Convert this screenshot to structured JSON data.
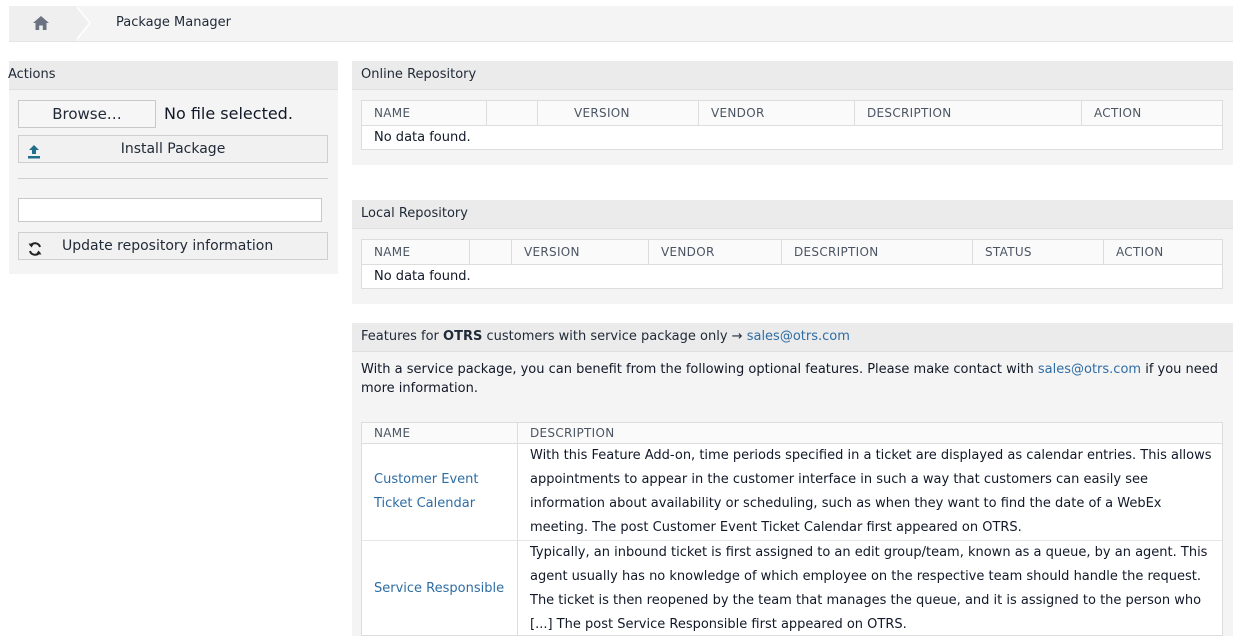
{
  "breadcrumb": {
    "home_icon": "home-icon",
    "current": "Package Manager"
  },
  "sidebar": {
    "title": "Actions",
    "browse_label": "Browse…",
    "file_status": "No file selected.",
    "install_label": "Install Package",
    "install_icon": "upload-icon",
    "repo_input_value": "",
    "update_label": "Update repository information",
    "update_icon": "refresh-icon"
  },
  "online_repo": {
    "title": "Online Repository",
    "columns": [
      "NAME",
      "",
      "VERSION",
      "VENDOR",
      "DESCRIPTION",
      "ACTION"
    ],
    "empty": "No data found."
  },
  "local_repo": {
    "title": "Local Repository",
    "columns": [
      "NAME",
      "",
      "VERSION",
      "VENDOR",
      "DESCRIPTION",
      "STATUS",
      "ACTION"
    ],
    "empty": "No data found."
  },
  "features": {
    "title_prefix": "Features for",
    "title_brand": "OTRS",
    "title_middle": "customers with service package only →",
    "title_link": "sales@otrs.com",
    "intro_text": "With a service package, you can benefit from the following optional features. Please make contact with",
    "intro_link": "sales@otrs.com",
    "intro_suffix": "if you need more information.",
    "columns": [
      "NAME",
      "DESCRIPTION"
    ],
    "rows": [
      {
        "name": "Customer Event Ticket Calendar",
        "description": "With this Feature Add-on, time periods specified in a ticket are displayed as calendar entries. This allows appointments to appear in the customer interface in such a way that customers can easily see information about availability or scheduling, such as when they want to find the date of a WebEx meeting. The post Customer Event Ticket Calendar first appeared on OTRS."
      },
      {
        "name": "Service Responsible",
        "description": "Typically, an inbound ticket is first assigned to an edit group/team, known as a queue, by an agent. This agent usually has no knowledge of which employee on the respective team should handle the request. The ticket is then reopened by the team that manages the queue, and it is assigned to the person who [...] The post Service Responsible first appeared on OTRS."
      }
    ]
  },
  "colors": {
    "link": "#2e6da4",
    "panel_bg": "#f4f4f4",
    "header_bg": "#ebebeb"
  }
}
